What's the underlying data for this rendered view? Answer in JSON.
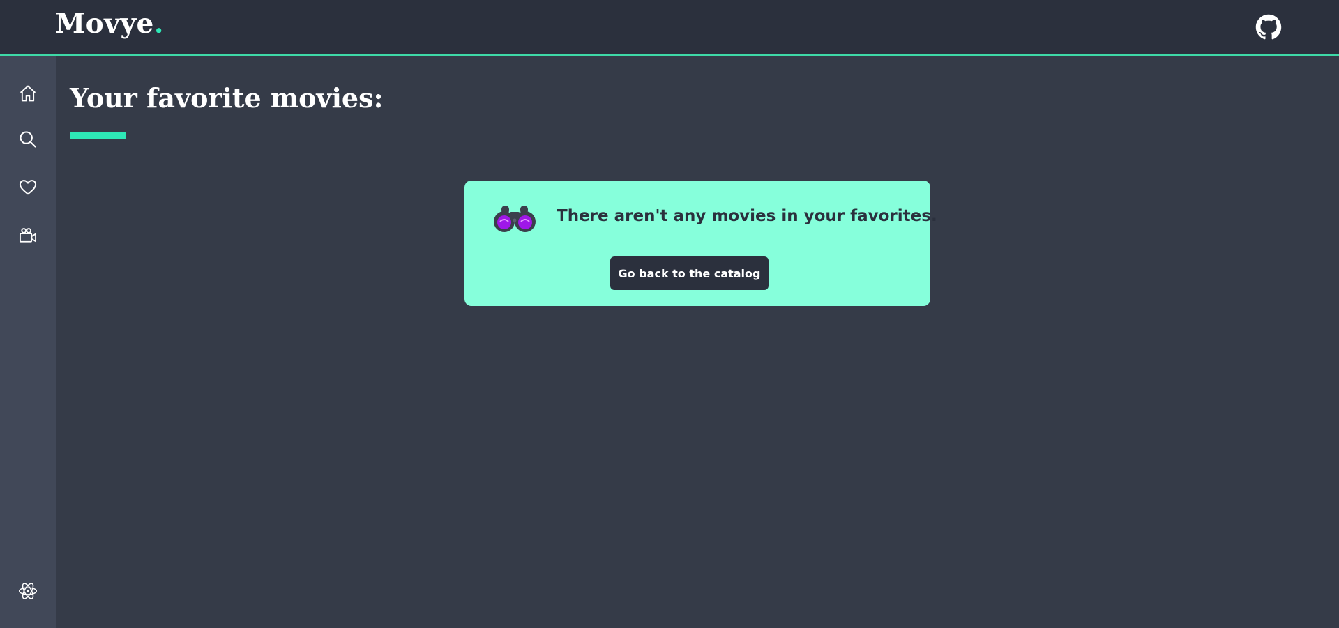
{
  "app": {
    "logo_text": "Movye",
    "logo_dot": ".",
    "accent_color": "#2ee8b6"
  },
  "header": {
    "github_icon": "github-icon"
  },
  "sidebar": {
    "items": [
      {
        "icon": "home-icon"
      },
      {
        "icon": "search-icon"
      },
      {
        "icon": "heart-icon"
      },
      {
        "icon": "video-camera-icon"
      }
    ],
    "footer_icon": "react-icon"
  },
  "main": {
    "title": "Your favorite movies:",
    "empty_state": {
      "icon": "binoculars-icon",
      "message": "There aren't any movies in your favorites.",
      "button_label": "Go back to the catalog",
      "card_color": "#86ffdb"
    }
  }
}
